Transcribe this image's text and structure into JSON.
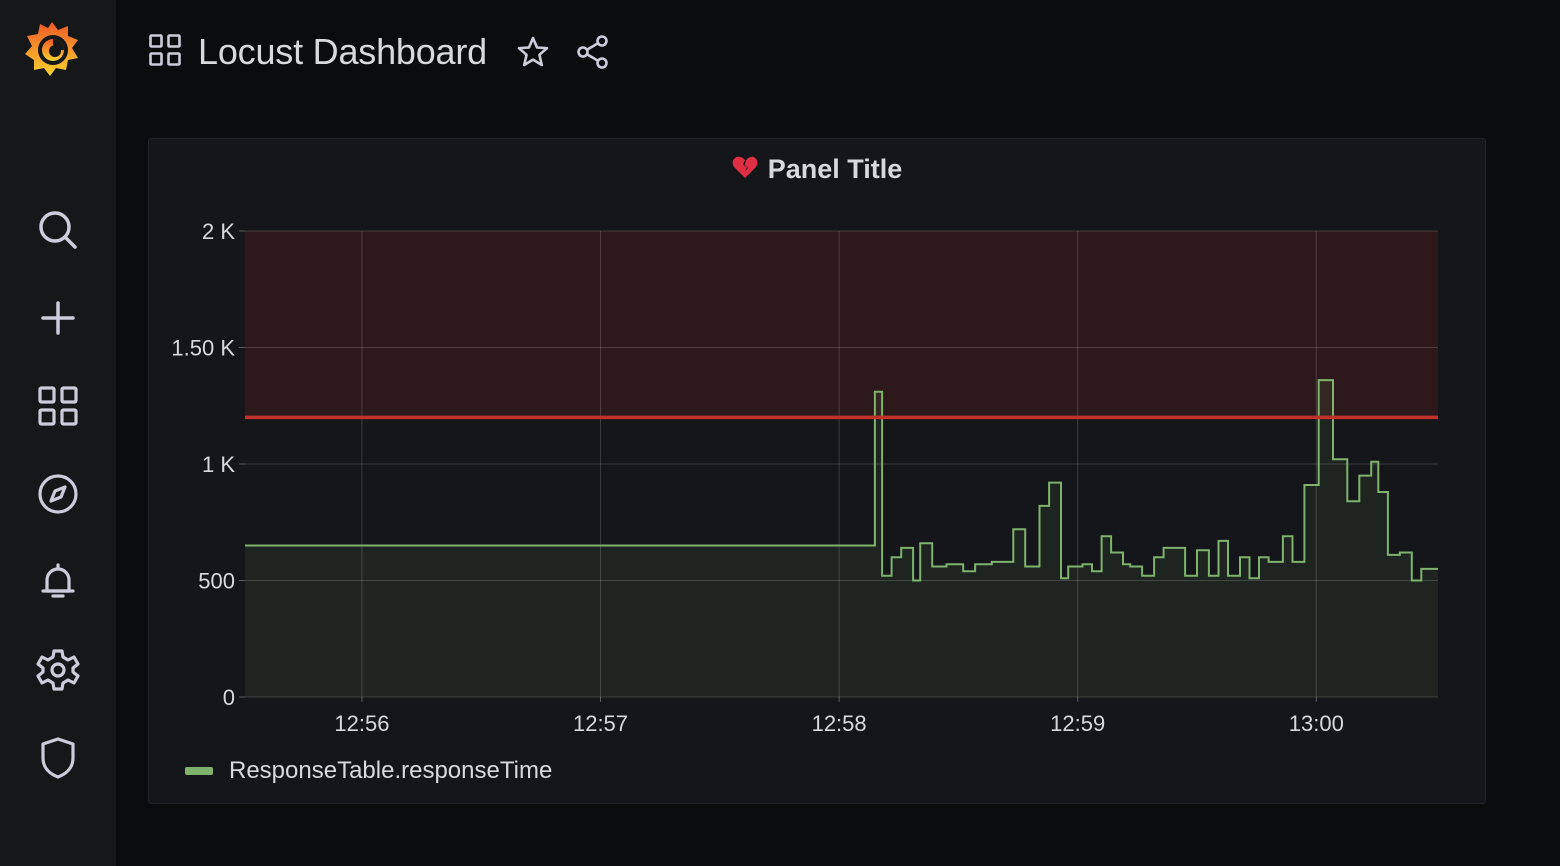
{
  "app": {
    "dashboard_title": "Locust Dashboard"
  },
  "sidebar": {
    "items": [
      {
        "name": "search",
        "icon": "search-icon"
      },
      {
        "name": "create",
        "icon": "plus-icon"
      },
      {
        "name": "dashboards",
        "icon": "grid-icon"
      },
      {
        "name": "explore",
        "icon": "compass-icon"
      },
      {
        "name": "alerting",
        "icon": "bell-icon"
      },
      {
        "name": "configuration",
        "icon": "gear-icon"
      },
      {
        "name": "server-admin",
        "icon": "shield-icon"
      }
    ]
  },
  "panel": {
    "title": "Panel Title",
    "status_icon": "broken-heart-icon",
    "status_color": "#e02f44"
  },
  "colors": {
    "series": "#7eb26d",
    "threshold": "#c4302b",
    "background": "#0b0c0e",
    "panel_bg": "#141619"
  },
  "chart_data": {
    "type": "line",
    "line_style": "step",
    "title": "Panel Title",
    "xlabel": "",
    "ylabel": "",
    "x_tick_labels": [
      "12:56",
      "12:57",
      "12:58",
      "12:59",
      "13:00"
    ],
    "x_tick_values_min": [
      0,
      1,
      2,
      3,
      4
    ],
    "y_tick_labels": [
      "0",
      "500",
      "1 K",
      "1.50 K",
      "2 K"
    ],
    "y_tick_values": [
      0,
      500,
      1000,
      1500,
      2000
    ],
    "xlim": [
      -0.49,
      4.51
    ],
    "ylim": [
      0,
      2000
    ],
    "x_unit_note": "minutes after 12:56",
    "threshold": 1200,
    "grid": true,
    "legend_position": "bottom-left",
    "series": [
      {
        "name": "ResponseTable.responseTime",
        "fill": true,
        "x": [
          -0.49,
          2.15,
          2.18,
          2.22,
          2.26,
          2.31,
          2.34,
          2.39,
          2.45,
          2.52,
          2.57,
          2.64,
          2.73,
          2.78,
          2.84,
          2.88,
          2.93,
          2.96,
          3.02,
          3.06,
          3.1,
          3.14,
          3.19,
          3.22,
          3.27,
          3.32,
          3.36,
          3.45,
          3.5,
          3.55,
          3.59,
          3.63,
          3.68,
          3.72,
          3.76,
          3.8,
          3.86,
          3.9,
          3.95,
          3.99,
          4.01,
          4.07,
          4.13,
          4.18,
          4.23,
          4.26,
          4.3,
          4.35,
          4.4,
          4.44,
          4.48
        ],
        "y": [
          650,
          1310,
          520,
          600,
          640,
          500,
          660,
          560,
          570,
          540,
          570,
          580,
          720,
          560,
          820,
          920,
          510,
          560,
          570,
          540,
          690,
          620,
          570,
          560,
          520,
          600,
          640,
          520,
          630,
          520,
          670,
          520,
          600,
          510,
          600,
          580,
          690,
          580,
          910,
          910,
          1360,
          1020,
          840,
          950,
          1010,
          880,
          610,
          620,
          500,
          550,
          550
        ]
      }
    ]
  }
}
